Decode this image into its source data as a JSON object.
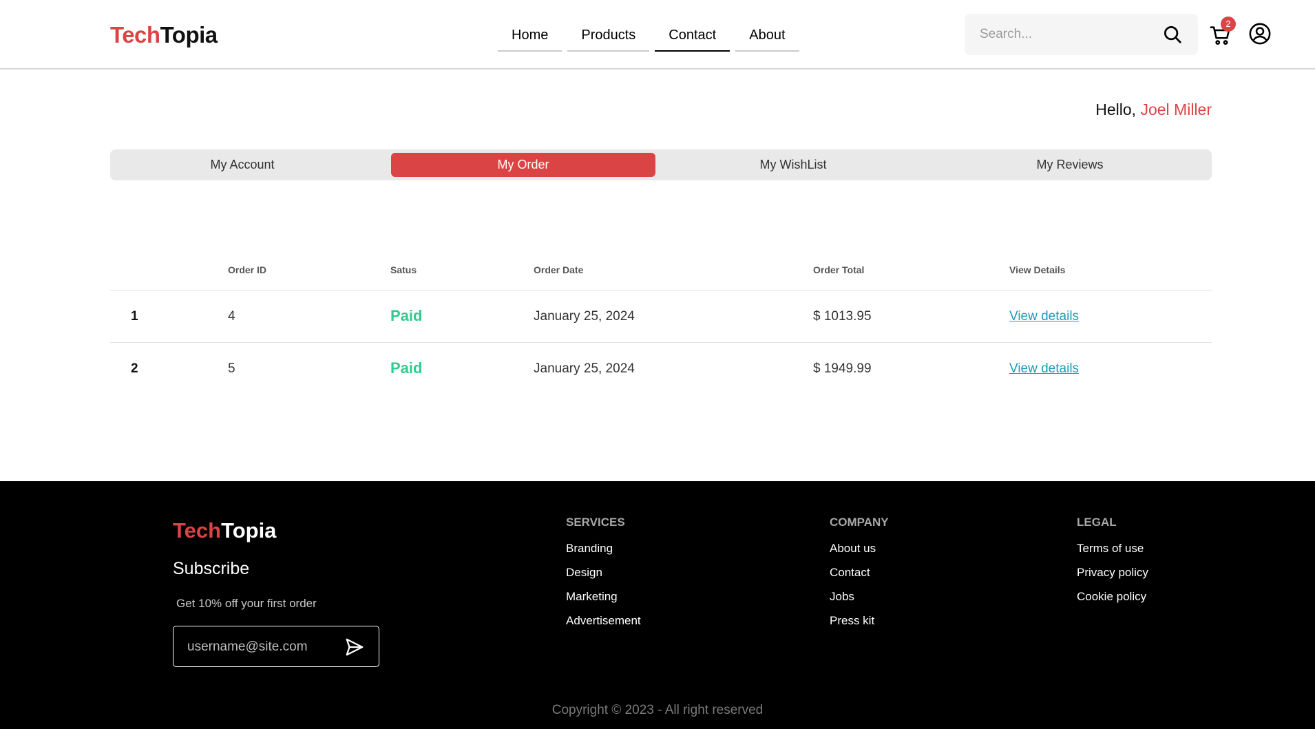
{
  "header": {
    "logo": {
      "part1": "Tech",
      "part2": "Topia"
    },
    "nav": [
      {
        "label": "Home"
      },
      {
        "label": "Products"
      },
      {
        "label": "Contact"
      },
      {
        "label": "About"
      }
    ],
    "active_nav": "Contact",
    "search": {
      "placeholder": "Search..."
    },
    "cart_count": "2"
  },
  "greeting": {
    "prefix": "Hello,",
    "name": "Joel Miller"
  },
  "tabs": [
    {
      "label": "My Account"
    },
    {
      "label": "My Order"
    },
    {
      "label": "My WishList"
    },
    {
      "label": "My Reviews"
    }
  ],
  "active_tab": "My Order",
  "orders": {
    "columns": [
      "Order ID",
      "Satus",
      "Order Date",
      "Order Total",
      "View Details"
    ],
    "rows": [
      {
        "index": "1",
        "order_id": "4",
        "status": "Paid",
        "date": "January 25, 2024",
        "total": "$ 1013.95",
        "link": "View details"
      },
      {
        "index": "2",
        "order_id": "5",
        "status": "Paid",
        "date": "January 25, 2024",
        "total": "$ 1949.99",
        "link": "View details"
      }
    ]
  },
  "footer": {
    "logo": {
      "part1": "Tech",
      "part2": "Topia"
    },
    "subscribe_title": "Subscribe",
    "offer": "Get 10% off your first order",
    "email_placeholder": "username@site.com",
    "columns": [
      {
        "title": "SERVICES",
        "links": [
          "Branding",
          "Design",
          "Marketing",
          "Advertisement"
        ]
      },
      {
        "title": "COMPANY",
        "links": [
          "About us",
          "Contact",
          "Jobs",
          "Press kit"
        ]
      },
      {
        "title": "LEGAL",
        "links": [
          "Terms of use",
          "Privacy policy",
          "Cookie policy"
        ]
      }
    ],
    "copyright": "Copyright © 2023 - All right reserved"
  },
  "colors": {
    "accent": "#db4444",
    "paid": "#2ecc8f",
    "link": "#1b9bb8"
  }
}
